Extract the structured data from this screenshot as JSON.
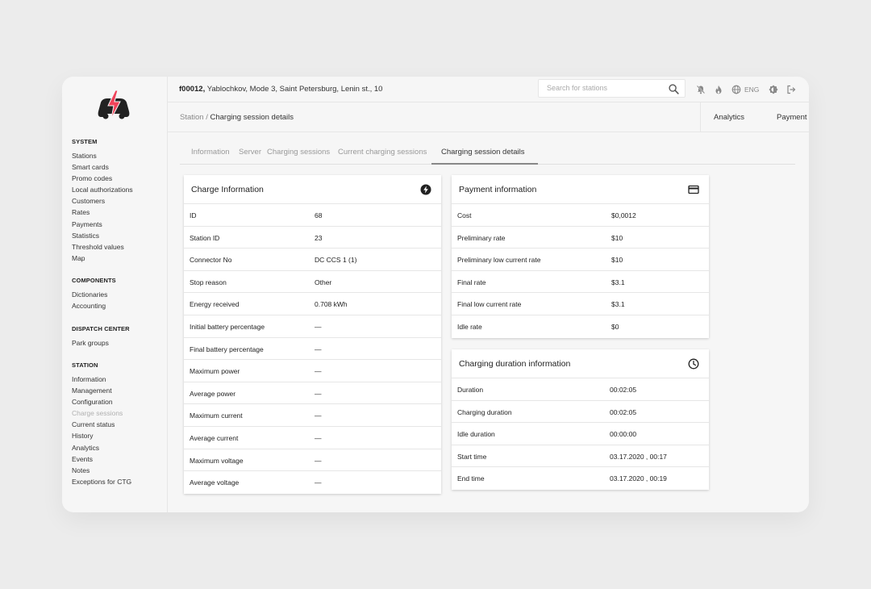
{
  "colors": {
    "brand": "#f0435a",
    "logo_dark": "#222222"
  },
  "header": {
    "station_id": "f00012,",
    "station_address": "Yablochkov, Mode 3, Saint Petersburg, Lenin st., 10",
    "search_placeholder": "Search for stations",
    "language": "ENG",
    "icons": [
      "bell-off-icon",
      "fire-icon",
      "globe-icon",
      "theme-icon",
      "logout-icon"
    ]
  },
  "breadcrumb": {
    "root": "Station",
    "separator": " / ",
    "current": "Charging session details"
  },
  "top_links": {
    "analytics": "Analytics",
    "payment": "Payment"
  },
  "sidebar": {
    "system": {
      "title": "SYSTEM",
      "items": [
        "Stations",
        "Smart cards",
        "Promo codes",
        "Local authorizations",
        "Customers",
        "Rates",
        "Payments",
        "Statistics",
        "Threshold values",
        "Map"
      ]
    },
    "components": {
      "title": "COMPONENTS",
      "items": [
        "Dictionaries",
        "Accounting"
      ]
    },
    "dispatch": {
      "title": "DISPATCH CENTER",
      "items": [
        "Park groups"
      ]
    },
    "station": {
      "title": "STATION",
      "items": [
        "Information",
        "Management",
        "Configuration",
        "Charge sessions",
        "Current status",
        "History",
        "Analytics",
        "Events",
        "Notes",
        "Exceptions for CTG"
      ]
    }
  },
  "tabs": [
    "Information",
    "Server",
    "Charging sessions",
    "Current charging sessions",
    "Charging session details"
  ],
  "charge_info": {
    "title": "Charge Information",
    "rows": [
      {
        "label": "ID",
        "value": "68"
      },
      {
        "label": "Station ID",
        "value": "23"
      },
      {
        "label": "Connector No",
        "value": "DC CCS 1 (1)"
      },
      {
        "label": "Stop reason",
        "value": "Other"
      },
      {
        "label": "Energy received",
        "value": "0.708 kWh"
      },
      {
        "label": "Initial battery percentage",
        "value": "—"
      },
      {
        "label": "Final battery percentage",
        "value": "—"
      },
      {
        "label": "Maximum power",
        "value": "—"
      },
      {
        "label": "Average power",
        "value": "—"
      },
      {
        "label": "Maximum current",
        "value": "—"
      },
      {
        "label": "Average current",
        "value": "—"
      },
      {
        "label": "Maximum voltage",
        "value": "—"
      },
      {
        "label": "Average voltage",
        "value": "—"
      }
    ]
  },
  "payment_info": {
    "title": "Payment information",
    "rows": [
      {
        "label": "Cost",
        "value": "$0,0012"
      },
      {
        "label": "Preliminary rate",
        "value": "$10"
      },
      {
        "label": "Preliminary low current rate",
        "value": "$10"
      },
      {
        "label": "Final rate",
        "value": "$3.1"
      },
      {
        "label": "Final low current rate",
        "value": "$3.1"
      },
      {
        "label": "Idle rate",
        "value": "$0"
      }
    ]
  },
  "duration_info": {
    "title": "Charging duration information",
    "rows": [
      {
        "label": "Duration",
        "value": "00:02:05"
      },
      {
        "label": "Charging duration",
        "value": "00:02:05"
      },
      {
        "label": "Idle duration",
        "value": "00:00:00"
      },
      {
        "label": "Start time",
        "value": "03.17.2020 , 00:17"
      },
      {
        "label": "End time",
        "value": "03.17.2020 , 00:19"
      }
    ]
  }
}
